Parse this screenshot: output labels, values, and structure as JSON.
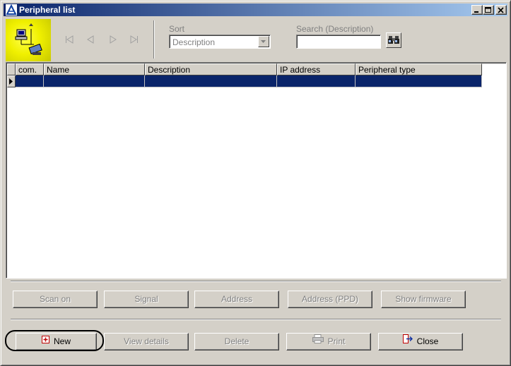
{
  "window": {
    "title": "Peripheral list",
    "app-icon": "delta-triangle-icon"
  },
  "title_buttons": {
    "minimize": "minimize-icon",
    "maximize": "maximize-icon",
    "close": "close-icon"
  },
  "toolbar": {
    "logo_icon": "peripherals-network-icon",
    "navigation": [
      "first-record-icon",
      "previous-record-icon",
      "next-record-icon",
      "last-record-icon"
    ],
    "sort_label": "Sort",
    "sort_value": "Description",
    "search_label": "Search (Description)",
    "search_value": "",
    "search_button_icon": "binoculars-icon"
  },
  "grid": {
    "columns": [
      "com.",
      "Name",
      "Description",
      "IP address",
      "Peripheral type"
    ],
    "rows": [
      [
        "",
        "",
        "",
        "",
        ""
      ]
    ],
    "selected_row": 0
  },
  "actions_row1": [
    {
      "label": "Scan on",
      "enabled": false
    },
    {
      "label": "Signal",
      "enabled": false
    },
    {
      "label": "Address",
      "enabled": false
    },
    {
      "label": "Address (PPD)",
      "enabled": false
    },
    {
      "label": "Show firmware",
      "enabled": false
    }
  ],
  "actions_row2": [
    {
      "label": "New",
      "enabled": true,
      "icon": "new-plus-icon"
    },
    {
      "label": "View details",
      "enabled": false
    },
    {
      "label": "Delete",
      "enabled": false
    },
    {
      "label": "Print",
      "enabled": false,
      "icon": "printer-icon"
    },
    {
      "label": "Close",
      "enabled": true,
      "icon": "exit-door-icon"
    }
  ],
  "colors": {
    "titlebar_start": "#0a246a",
    "titlebar_end": "#a6caf0",
    "selection": "#0a246a",
    "face": "#d4d0c8",
    "logo_yellow": "#f0f000"
  }
}
